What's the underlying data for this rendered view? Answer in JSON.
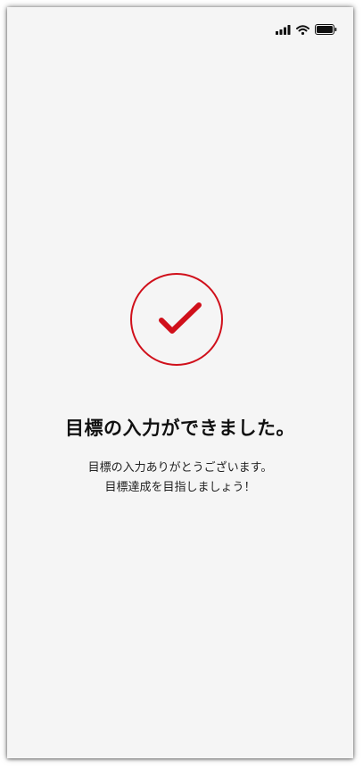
{
  "status_bar": {
    "icons": [
      "signal-icon",
      "wifi-icon",
      "battery-icon"
    ]
  },
  "completion": {
    "icon": "checkmark-icon",
    "accent_color": "#d0101b",
    "title": "目標の入力ができました。",
    "message_line1": "目標の入力ありがとうございます。",
    "message_line2": "目標達成を目指しましょう！"
  }
}
